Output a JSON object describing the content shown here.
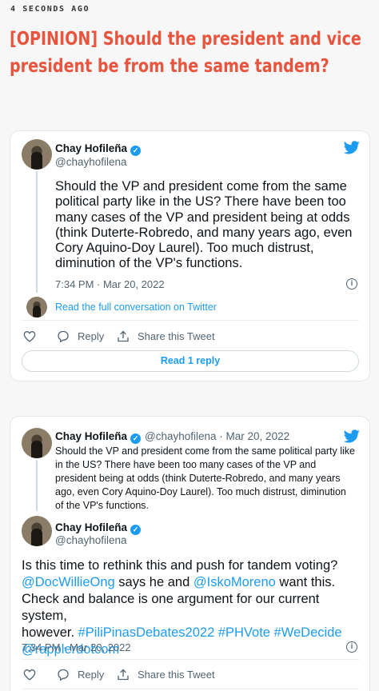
{
  "article": {
    "timestamp": "4 SECONDS AGO",
    "headline": "[OPINION] Should the president and vice president be from the same tandem?"
  },
  "colors": {
    "accent": "#e8553e",
    "twitter_blue": "#1d9bf0",
    "muted": "#536471"
  },
  "tweet1": {
    "author": "Chay Hofileña",
    "handle": "@chayhofilena",
    "text_lines": [
      "Should the VP and president come from the same",
      "political party like in the US? There have been too",
      "many cases of the VP and president being at odds",
      "(think Duterte-Robredo, and many years ago, even",
      "Cory Aquino-Doy Laurel). Too much distrust,",
      "diminution of the VP's functions."
    ],
    "time": "7:34 PM · Mar 20, 2022",
    "full_conversation": "Read the full conversation on Twitter",
    "reply_label": "Reply",
    "share_label": "Share this Tweet",
    "read_replies": "Read 1 reply"
  },
  "tweet2": {
    "quoted": {
      "author": "Chay Hofileña",
      "handle_date": "@chayhofilena · Mar 20, 2022",
      "text_lines": [
        "Should the VP and president come from the same political party like",
        "in the US? There have been too many cases of the VP and",
        "president being at odds (think Duterte-Robredo, and many years",
        "ago, even Cory Aquino-Doy Laurel). Too much distrust, diminution",
        "of the VP's functions."
      ]
    },
    "author": "Chay Hofileña",
    "handle": "@chayhofilena",
    "line1": "Is this time to rethink this and push for tandem voting?",
    "mention1": "@DocWillieOng",
    "line2_mid": " says he and ",
    "mention2": "@IskoMoreno",
    "line2_end": " want this.",
    "line3": "Check and balance is one argument for our current system,",
    "line4_start": "however. ",
    "hashtags": "#PiliPinasDebates2022 #PHVote #WeDecide",
    "mention3": "@rapplerdotcom",
    "time": "7:34 PM · Mar 20, 2022",
    "reply_label": "Reply",
    "share_label": "Share this Tweet"
  }
}
